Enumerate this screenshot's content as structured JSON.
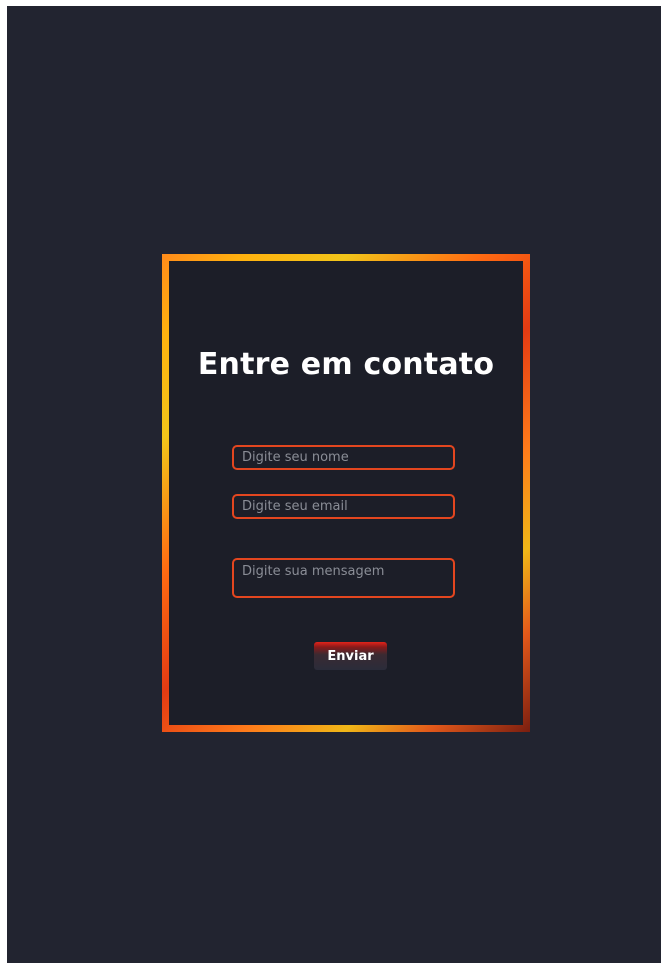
{
  "contact": {
    "title": "Entre em contato",
    "name_placeholder": "Digite seu nome",
    "email_placeholder": "Digite seu email",
    "message_placeholder": "Digite sua mensagem",
    "send_label": "Enviar"
  },
  "colors": {
    "background": "#222430",
    "card": "#1c1e28",
    "field_border": "#e3461f",
    "accent_red": "#e3241a",
    "frame_orange": "#ff8a1a",
    "frame_yellow": "#f2c51a"
  }
}
